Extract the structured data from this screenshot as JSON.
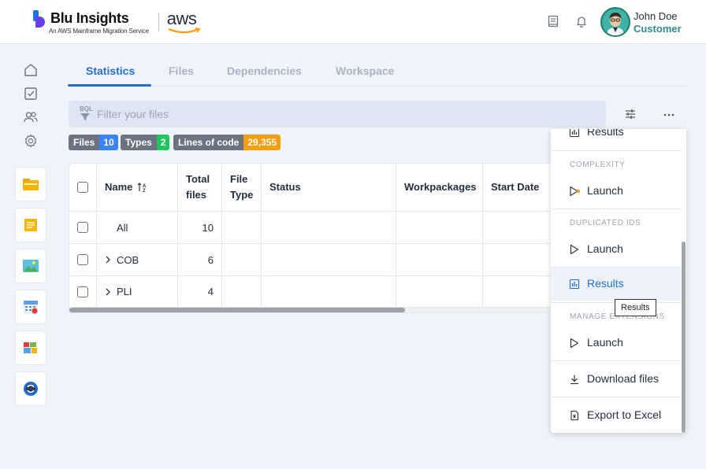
{
  "brand": {
    "product_name": "Blu Insights",
    "tagline": "An AWS Mainframe Migration Service",
    "partner": "aws"
  },
  "header": {
    "icons": [
      "book-icon",
      "bell-icon"
    ],
    "user": {
      "name": "John Doe",
      "role": "Customer"
    }
  },
  "rail": {
    "nav_icons": [
      "home-icon",
      "checklist-icon",
      "users-icon",
      "settings-icon"
    ],
    "apps": [
      "folder-app",
      "notes-app",
      "image-app",
      "calendar-app",
      "blocks-app",
      "refresh-app"
    ]
  },
  "tabs": [
    {
      "label": "Statistics",
      "active": true
    },
    {
      "label": "Files",
      "active": false
    },
    {
      "label": "Dependencies",
      "active": false
    },
    {
      "label": "Workspace",
      "active": false
    }
  ],
  "filter": {
    "tag": "BQL",
    "placeholder": "Filter your files"
  },
  "badges": [
    {
      "label": "Files",
      "count": "10",
      "color": "#3b82f6"
    },
    {
      "label": "Types",
      "count": "2",
      "color": "#22c55e"
    },
    {
      "label": "Lines of code",
      "count": "29,355",
      "color": "#f59e0b"
    }
  ],
  "table": {
    "columns": [
      "Name",
      "Total files",
      "File Type",
      "Status",
      "Workpackages",
      "Start Date"
    ],
    "rows": [
      {
        "name": "All",
        "total": "10",
        "expandable": false
      },
      {
        "name": "COB",
        "total": "6",
        "expandable": true
      },
      {
        "name": "PLI",
        "total": "4",
        "expandable": true
      }
    ]
  },
  "menu": {
    "items": [
      {
        "type": "item",
        "label": "Results",
        "icon": "chart-icon"
      },
      {
        "type": "section",
        "label": "COMPLEXITY"
      },
      {
        "type": "item",
        "label": "Launch",
        "icon": "play-running-icon"
      },
      {
        "type": "section",
        "label": "DUPLICATED IDS"
      },
      {
        "type": "item",
        "label": "Launch",
        "icon": "play-icon"
      },
      {
        "type": "item",
        "label": "Results",
        "icon": "chart-icon",
        "hover": true
      },
      {
        "type": "section",
        "label": "MANAGE EXTENSIONS"
      },
      {
        "type": "item",
        "label": "Launch",
        "icon": "play-icon"
      },
      {
        "type": "item",
        "label": "Download files",
        "icon": "download-icon"
      },
      {
        "type": "item",
        "label": "Export to Excel",
        "icon": "excel-icon"
      }
    ]
  },
  "tooltip": "Results"
}
